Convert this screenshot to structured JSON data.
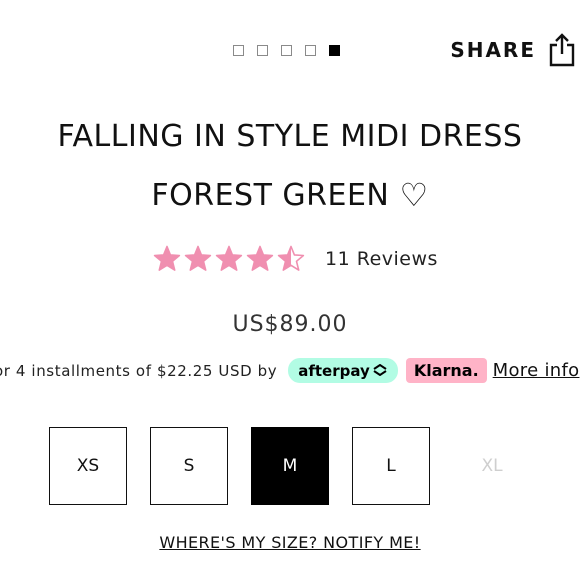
{
  "carousel": {
    "dot_count": 5,
    "active_index": 4
  },
  "share": {
    "label": "SHARE",
    "icon": "share-upload-icon"
  },
  "product": {
    "title_line1": "FALLING IN STYLE MIDI DRESS",
    "title_line2": "FOREST GREEN",
    "wishlist_icon": "♡",
    "price": "US$89.00"
  },
  "rating": {
    "value": 4.5,
    "max": 5,
    "star_color": "#f08fb0",
    "reviews_label": "11 Reviews"
  },
  "installments": {
    "text": "or 4 installments of $22.25 USD by",
    "afterpay_label": "afterpay",
    "afterpay_color": "#b2fce4",
    "klarna_label": "Klarna.",
    "klarna_color": "#ffb3c7",
    "more_info_label": "More info"
  },
  "sizes": [
    {
      "label": "XS",
      "state": "available"
    },
    {
      "label": "S",
      "state": "available"
    },
    {
      "label": "M",
      "state": "selected"
    },
    {
      "label": "L",
      "state": "available"
    },
    {
      "label": "XL",
      "state": "unavailable"
    }
  ],
  "notify": {
    "label": "WHERE'S MY SIZE? NOTIFY ME!"
  }
}
